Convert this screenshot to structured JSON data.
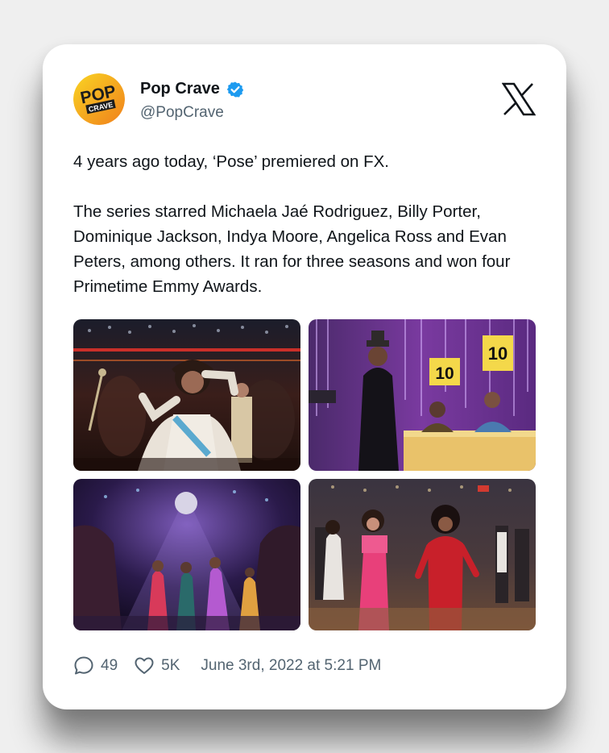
{
  "tweet": {
    "author": {
      "name": "Pop Crave",
      "handle": "@PopCrave",
      "verified": true,
      "avatar_text_top": "POP",
      "avatar_text_bottom": "CRAVE"
    },
    "platform_icon": "x-logo-icon",
    "text_paragraphs": [
      "4 years ago today, ‘Pose’ premiered on FX.",
      "The series starred Michaela Jaé Rodriguez, Billy Porter, Dominique Jackson, Indya Moore, Angelica Ross and Evan Peters, among others. It ran for three seasons and won four Primetime Emmy Awards."
    ],
    "photos": {
      "photo2": {
        "score_left": "10",
        "score_right": "10"
      }
    },
    "stats": {
      "replies": "49",
      "likes": "5K",
      "date": "June 3rd, 2022 at 5:21 PM"
    }
  },
  "colors": {
    "verified_blue": "#1d9bf0",
    "text_primary": "#0f1419",
    "text_secondary": "#536471",
    "avatar_yellow": "#f7c21b",
    "avatar_orange": "#f0801c"
  }
}
